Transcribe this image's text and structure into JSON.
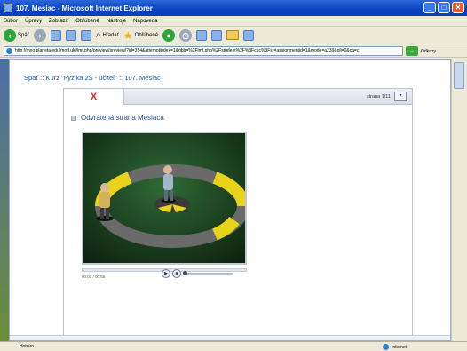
{
  "window": {
    "title": "107. Mesiac - Microsoft Internet Explorer"
  },
  "menu": [
    "Súbor",
    "Úpravy",
    "Zobraziť",
    "Obľúbené",
    "Nástroje",
    "Nápoveda"
  ],
  "toolbar": {
    "back_label": "Späť",
    "search_label": "Hľadať",
    "favorites_label": "Obľúbené"
  },
  "address": {
    "url": "http://moo.planeta.edu/mod.ukl/lmt.php/preview/preview/?id=354&attemptindex=1&gbb=%2Flmt.php%2Fstudent%2F%3Fcuc%3Fsr=assignmentid=1&mode=a239&pli=0&ca=c",
    "links_label": "Odkazy"
  },
  "breadcrumb": {
    "back": "Späť",
    "course": "Kurz \"Fyzika 2S - učiteľ\"",
    "page": "107. Mesiac"
  },
  "module": {
    "close_symbol": "X",
    "page_info": "strana 1/11",
    "section_title": "Odvrátená strana Mesiaca"
  },
  "player": {
    "time": "00:00 / 00:55",
    "progress": 0.0
  },
  "status": {
    "left": "Hotovo",
    "zone": "Internet"
  }
}
